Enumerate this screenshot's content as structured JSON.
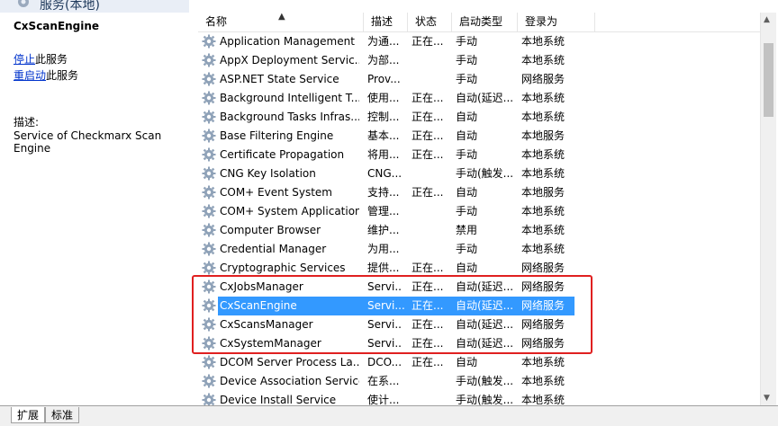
{
  "window": {
    "title": "服务(本地)"
  },
  "detail": {
    "service_name": "CxScanEngine",
    "stop_link": "停止",
    "stop_suffix": "此服务",
    "restart_link": "重启动",
    "restart_suffix": "此服务",
    "desc_label": "描述:",
    "description": "Service of Checkmarx Scan Engine"
  },
  "columns": {
    "name": "名称",
    "desc": "描述",
    "status": "状态",
    "startup": "启动类型",
    "logon": "登录为"
  },
  "rows": [
    {
      "name": "Application Management",
      "desc": "为通...",
      "status": "正在...",
      "startup": "手动",
      "logon": "本地系统"
    },
    {
      "name": "AppX Deployment Servic...",
      "desc": "为部...",
      "status": "",
      "startup": "手动",
      "logon": "本地系统"
    },
    {
      "name": "ASP.NET State Service",
      "desc": "Prov...",
      "status": "",
      "startup": "手动",
      "logon": "网络服务"
    },
    {
      "name": "Background Intelligent T...",
      "desc": "使用...",
      "status": "正在...",
      "startup": "自动(延迟...",
      "logon": "本地系统"
    },
    {
      "name": "Background Tasks Infras...",
      "desc": "控制...",
      "status": "正在...",
      "startup": "自动",
      "logon": "本地系统"
    },
    {
      "name": "Base Filtering Engine",
      "desc": "基本...",
      "status": "正在...",
      "startup": "自动",
      "logon": "本地服务"
    },
    {
      "name": "Certificate Propagation",
      "desc": "将用...",
      "status": "正在...",
      "startup": "手动",
      "logon": "本地系统"
    },
    {
      "name": "CNG Key Isolation",
      "desc": "CNG...",
      "status": "",
      "startup": "手动(触发...",
      "logon": "本地系统"
    },
    {
      "name": "COM+ Event System",
      "desc": "支持...",
      "status": "正在...",
      "startup": "自动",
      "logon": "本地服务"
    },
    {
      "name": "COM+ System Application",
      "desc": "管理...",
      "status": "",
      "startup": "手动",
      "logon": "本地系统"
    },
    {
      "name": "Computer Browser",
      "desc": "维护...",
      "status": "",
      "startup": "禁用",
      "logon": "本地系统"
    },
    {
      "name": "Credential Manager",
      "desc": "为用...",
      "status": "",
      "startup": "手动",
      "logon": "本地系统"
    },
    {
      "name": "Cryptographic Services",
      "desc": "提供...",
      "status": "正在...",
      "startup": "自动",
      "logon": "网络服务"
    },
    {
      "name": "CxJobsManager",
      "desc": "Servi...",
      "status": "正在...",
      "startup": "自动(延迟...",
      "logon": "网络服务"
    },
    {
      "name": "CxScanEngine",
      "desc": "Servi...",
      "status": "正在...",
      "startup": "自动(延迟...",
      "logon": "网络服务"
    },
    {
      "name": "CxScansManager",
      "desc": "Servi...",
      "status": "正在...",
      "startup": "自动(延迟...",
      "logon": "网络服务"
    },
    {
      "name": "CxSystemManager",
      "desc": "Servi...",
      "status": "正在...",
      "startup": "自动(延迟...",
      "logon": "网络服务"
    },
    {
      "name": "DCOM Server Process La...",
      "desc": "DCO...",
      "status": "正在...",
      "startup": "自动",
      "logon": "本地系统"
    },
    {
      "name": "Device Association Service",
      "desc": "在系...",
      "status": "",
      "startup": "手动(触发...",
      "logon": "本地系统"
    },
    {
      "name": "Device Install Service",
      "desc": "使计...",
      "status": "",
      "startup": "手动(触发...",
      "logon": "本地系统"
    }
  ],
  "selected_index": 14,
  "tabs": {
    "extended": "扩展",
    "standard": "标准"
  },
  "colors": {
    "selection": "#3399ff",
    "annotation": "#e02020",
    "link": "#0033cc"
  }
}
